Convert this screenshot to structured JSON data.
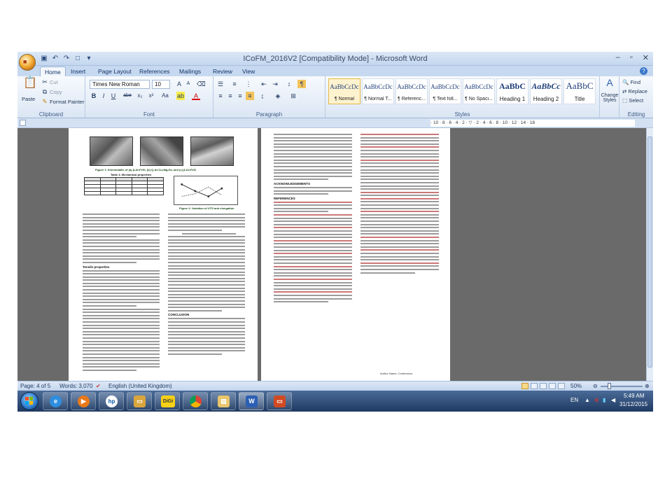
{
  "window": {
    "title": "ICoFM_2016V2 [Compatibility Mode] - Microsoft Word",
    "quick_access": [
      "save-icon",
      "undo-icon",
      "redo-icon",
      "new-doc-icon",
      "customize-icon"
    ],
    "controls": [
      "–",
      "▫",
      "✕"
    ]
  },
  "ribbon_tabs": [
    "Home",
    "Insert",
    "Page Layout",
    "References",
    "Mailings",
    "Review",
    "View"
  ],
  "clipboard": {
    "paste": "Paste",
    "cut": "Cut",
    "copy": "Copy",
    "format_painter": "Format Painter",
    "label": "Clipboard"
  },
  "font": {
    "family": "Times New Roman",
    "size": "10",
    "label": "Font",
    "buttons": [
      "B",
      "I",
      "U",
      "abe",
      "x₂",
      "x²",
      "Aa",
      "A"
    ]
  },
  "paragraph": {
    "label": "Paragraph"
  },
  "styles": {
    "label": "Styles",
    "items": [
      {
        "sample": "AaBbCcDc",
        "name": "¶ Normal",
        "active": true
      },
      {
        "sample": "AaBbCcDc",
        "name": "¶ Normal T...",
        "active": false
      },
      {
        "sample": "AaBbCcDc",
        "name": "¶ Referenc...",
        "active": false
      },
      {
        "sample": "AaBbCcDc",
        "name": "¶ Text foll...",
        "active": false
      },
      {
        "sample": "AaBbCcDc",
        "name": "¶ No Spaci...",
        "active": false
      },
      {
        "sample": "AaBbC",
        "name": "Heading 1",
        "active": false
      },
      {
        "sample": "AaBbCc",
        "name": "Heading 2",
        "active": false
      },
      {
        "sample": "AaBbC",
        "name": "Title",
        "active": false
      }
    ],
    "change_styles": "Change Styles"
  },
  "editing": {
    "label": "Editing",
    "find": "Find",
    "replace": "Replace",
    "select": "Select"
  },
  "document": {
    "left_page": {
      "figure_caption": "Figure 1: Intermetallic of (a) β-Al₅FeSi, (b) Q-Al₅Cu₂Mg₈Si₆ and (c) β-Al₅FeSi",
      "table_caption": "Table 4: Mechanical properties",
      "graph_caption": "Figure 2: Variation of UTS and elongation",
      "section_tensile": "Tensile properties",
      "section_conclusion": "CONCLUSION"
    },
    "right_page": {
      "section_ack": "ACKNOWLEDGEMENTS",
      "section_refs": "REFERENCES",
      "footer": "Author Name: Conference"
    }
  },
  "status": {
    "page": "Page: 4 of 5",
    "words": "Words: 3,070",
    "language": "English (United Kingdom)",
    "zoom": "50%"
  },
  "taskbar": {
    "apps": [
      "internet-explorer-icon",
      "media-player-icon",
      "hp-icon",
      "folder-icon",
      "digi-icon",
      "chrome-icon",
      "explorer-icon",
      "word-icon",
      "powerpoint-icon"
    ],
    "digi_label": "DiGi",
    "hp_label": "hp",
    "word_label": "W",
    "lang": "EN",
    "time": "5:49 AM",
    "date": "31/12/2015"
  }
}
